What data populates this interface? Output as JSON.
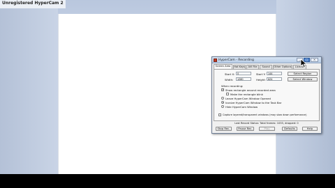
{
  "desktop": {
    "watermark": "Unregistered HyperCam 2"
  },
  "dialog": {
    "title": "HyperCam - Recording",
    "window_buttons": {
      "minimize": "_",
      "maximize": "□",
      "close": "×"
    },
    "tabs": [
      {
        "label": "Screen Area",
        "active": true
      },
      {
        "label": "Hot Keys",
        "active": false
      },
      {
        "label": "AVI File",
        "active": false
      },
      {
        "label": "Sound",
        "active": false
      },
      {
        "label": "Other Options",
        "active": false
      },
      {
        "label": "License",
        "active": false
      }
    ],
    "area": {
      "start_x_label": "Start X:",
      "start_x": "0",
      "start_y_label": "Start Y:",
      "start_y": "144",
      "width_label": "Width:",
      "width": "1280",
      "height_label": "Height:",
      "height": "624",
      "select_region": "Select Region",
      "select_window": "Select Window"
    },
    "when_recording": {
      "heading": "When recording:",
      "show_rectangle": {
        "label": "Show rectangle around recorded area",
        "checked": true
      },
      "blink_rectangle": {
        "label": "Make the rectangle blink",
        "checked": false
      },
      "radios": [
        {
          "label": "Leave HyperCam Window Opened",
          "selected": false
        },
        {
          "label": "Iconize HyperCam Window to the Task Bar",
          "selected": true
        },
        {
          "label": "Hide HyperCam Window",
          "selected": false
        }
      ]
    },
    "capture_layered": {
      "label": "Capture layered/transparent windows (may slow down performance)",
      "checked": false
    },
    "status_text": "Last Record Status: Total frames: 1033, dropped: 0",
    "buttons": {
      "stop_rec": "Stop Rec.",
      "pause_rec": "Pause Rec.",
      "play": "Play",
      "defaults": "Defaults",
      "help": "Help"
    }
  }
}
